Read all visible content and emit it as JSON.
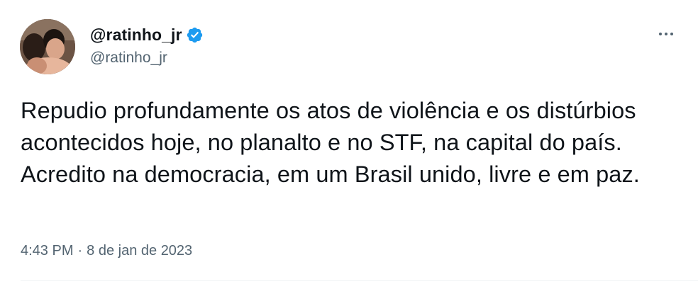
{
  "tweet": {
    "author": {
      "display_name": "@ratinho_jr",
      "handle": "@ratinho_jr",
      "verified": true
    },
    "text": "Repudio profundamente os atos de violência e os distúrbios acontecidos hoje, no planalto e no STF, na capital do país. Acredito na democracia, em um Brasil unido, livre e em paz.",
    "time": "4:43 PM",
    "separator": "·",
    "date": "8 de jan de 2023"
  },
  "icons": {
    "verified": "verified-badge-icon",
    "more": "more-options-icon"
  },
  "colors": {
    "text_primary": "#0f1419",
    "text_secondary": "#536471",
    "verified_blue": "#1d9bf0",
    "divider": "#eff3f4"
  }
}
